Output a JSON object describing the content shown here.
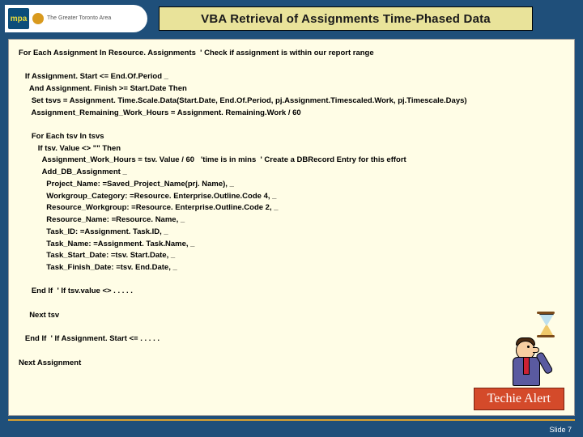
{
  "logo": {
    "abbrev": "mpa",
    "sub": "The Greater Toronto Area"
  },
  "title": "VBA Retrieval of Assignments Time-Phased Data",
  "code": {
    "l01": "For Each Assignment In Resource. Assignments  ' Check if assignment is within our report range",
    "l02": "",
    "l03": "   If Assignment. Start <= End.Of.Period _",
    "l04": "     And Assignment. Finish >= Start.Date Then",
    "l05": "      Set tsvs = Assignment. Time.Scale.Data(Start.Date, End.Of.Period, pj.Assignment.Timescaled.Work, pj.Timescale.Days)",
    "l06": "      Assignment_Remaining_Work_Hours = Assignment. Remaining.Work / 60",
    "l07": "",
    "l08": "      For Each tsv In tsvs",
    "l09": "         If tsv. Value <> \"\" Then",
    "l10": "           Assignment_Work_Hours = tsv. Value / 60   'time is in mins  ' Create a DBRecord Entry for this effort",
    "l11": "           Add_DB_Assignment _",
    "l12": "             Project_Name: =Saved_Project_Name(prj. Name), _",
    "l13": "             Workgroup_Category: =Resource. Enterprise.Outline.Code 4, _",
    "l14": "             Resource_Workgroup: =Resource. Enterprise.Outline.Code 2, _",
    "l15": "             Resource_Name: =Resource. Name, _",
    "l16": "             Task_ID: =Assignment. Task.ID, _",
    "l17": "             Task_Name: =Assignment. Task.Name, _",
    "l18": "             Task_Start_Date: =tsv. Start.Date, _",
    "l19": "             Task_Finish_Date: =tsv. End.Date, _",
    "l20": "",
    "l21": "      End If  ' If tsv.value <> . . . . .",
    "l22": "",
    "l23": "     Next tsv",
    "l24": "",
    "l25": "   End If  ' If Assignment. Start <= . . . . .",
    "l26": "",
    "l27": "Next Assignment"
  },
  "alert": "Techie Alert",
  "footer": {
    "slide": "Slide  7"
  }
}
